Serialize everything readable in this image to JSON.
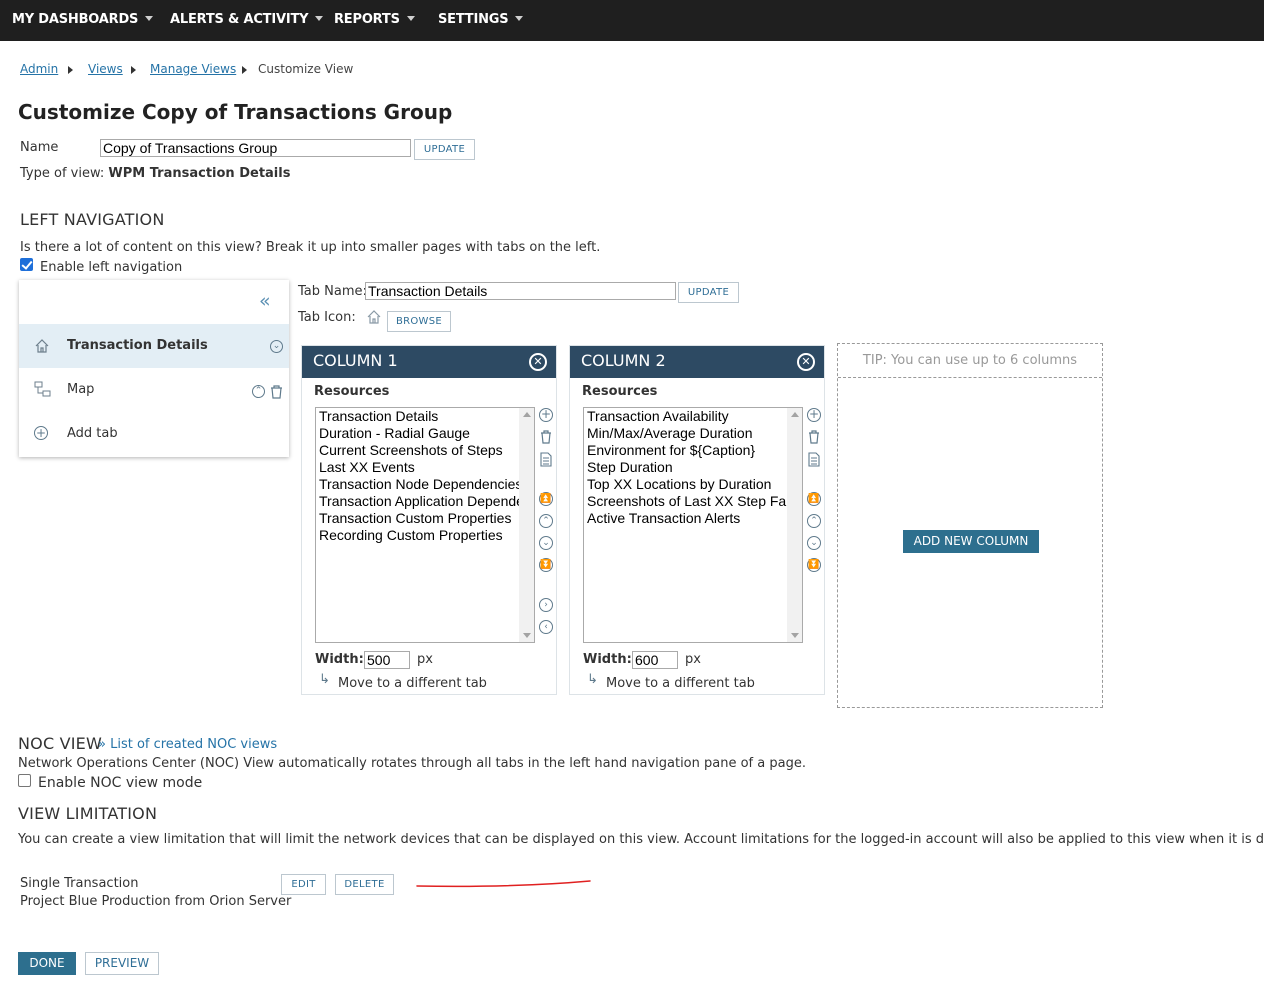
{
  "topnav": {
    "items": [
      {
        "label": "MY DASHBOARDS"
      },
      {
        "label": "ALERTS & ACTIVITY"
      },
      {
        "label": "REPORTS"
      },
      {
        "label": "SETTINGS"
      }
    ]
  },
  "breadcrumb": {
    "links": [
      "Admin",
      "Views",
      "Manage Views"
    ],
    "current": "Customize View"
  },
  "page": {
    "title": "Customize Copy of Transactions Group",
    "name_label": "Name",
    "name_value": "Copy of Transactions Group",
    "update_label": "UPDATE",
    "type_label": "Type of view:",
    "type_value": "WPM Transaction Details"
  },
  "left_navigation": {
    "heading": "LEFT NAVIGATION",
    "description": "Is there a lot of content on this view? Break it up into smaller pages with tabs on the left.",
    "enable_label": "Enable left navigation",
    "enabled": true,
    "collapse_icon": "double-chevron-left-icon",
    "tabs": [
      {
        "label": "Transaction Details",
        "icon": "home-icon",
        "active": true
      },
      {
        "label": "Map",
        "icon": "network-map-icon",
        "active": false
      }
    ],
    "add_tab_label": "Add tab",
    "tab_name_label": "Tab Name:",
    "tab_name_value": "Transaction Details",
    "tab_update_label": "UPDATE",
    "tab_icon_label": "Tab Icon:",
    "browse_label": "BROWSE"
  },
  "columns": [
    {
      "title": "COLUMN 1",
      "resources_label": "Resources",
      "resources": [
        "Transaction Details",
        "Duration - Radial Gauge",
        "Current Screenshots of Steps",
        "Last XX Events",
        "Transaction Node Dependencies",
        "Transaction Application Dependencies",
        "Transaction Custom Properties",
        "Recording Custom Properties"
      ],
      "width_label": "Width:",
      "width_value": "500",
      "width_unit": "px",
      "move_label": "Move to a different tab"
    },
    {
      "title": "COLUMN 2",
      "resources_label": "Resources",
      "resources": [
        "Transaction Availability",
        "Min/Max/Average Duration",
        "Environment for ${Caption}",
        "Step Duration",
        "Top XX Locations by Duration",
        "Screenshots of Last XX Step Failures",
        "Active Transaction Alerts"
      ],
      "width_label": "Width:",
      "width_value": "600",
      "width_unit": "px",
      "move_label": "Move to a different tab"
    }
  ],
  "tip": {
    "text": "TIP: You can use up to 6 columns",
    "add_column_label": "ADD NEW COLUMN"
  },
  "noc": {
    "heading": "NOC VIEW",
    "link": "» List of created NOC views",
    "description": "Network Operations Center (NOC) View automatically rotates through all tabs in the left hand navigation pane of a page.",
    "enable_label": "Enable NOC view mode",
    "enabled": false
  },
  "view_limitation": {
    "heading": "VIEW LIMITATION",
    "description": "You can create a view limitation that will limit the network devices that can be displayed on this view. Account limitations for the logged-in account will also be applied to this view when it is displayed.",
    "limit_type": "Single Transaction",
    "limit_value": "Project Blue Production from Orion Server",
    "edit_label": "EDIT",
    "delete_label": "DELETE"
  },
  "footer": {
    "done_label": "DONE",
    "preview_label": "PREVIEW"
  },
  "colors": {
    "topbar": "#1f1f1f",
    "column_header": "#2d4a63",
    "primary_button": "#2d6f8e",
    "link": "#2573a7",
    "annotation_line": "#e02020"
  }
}
